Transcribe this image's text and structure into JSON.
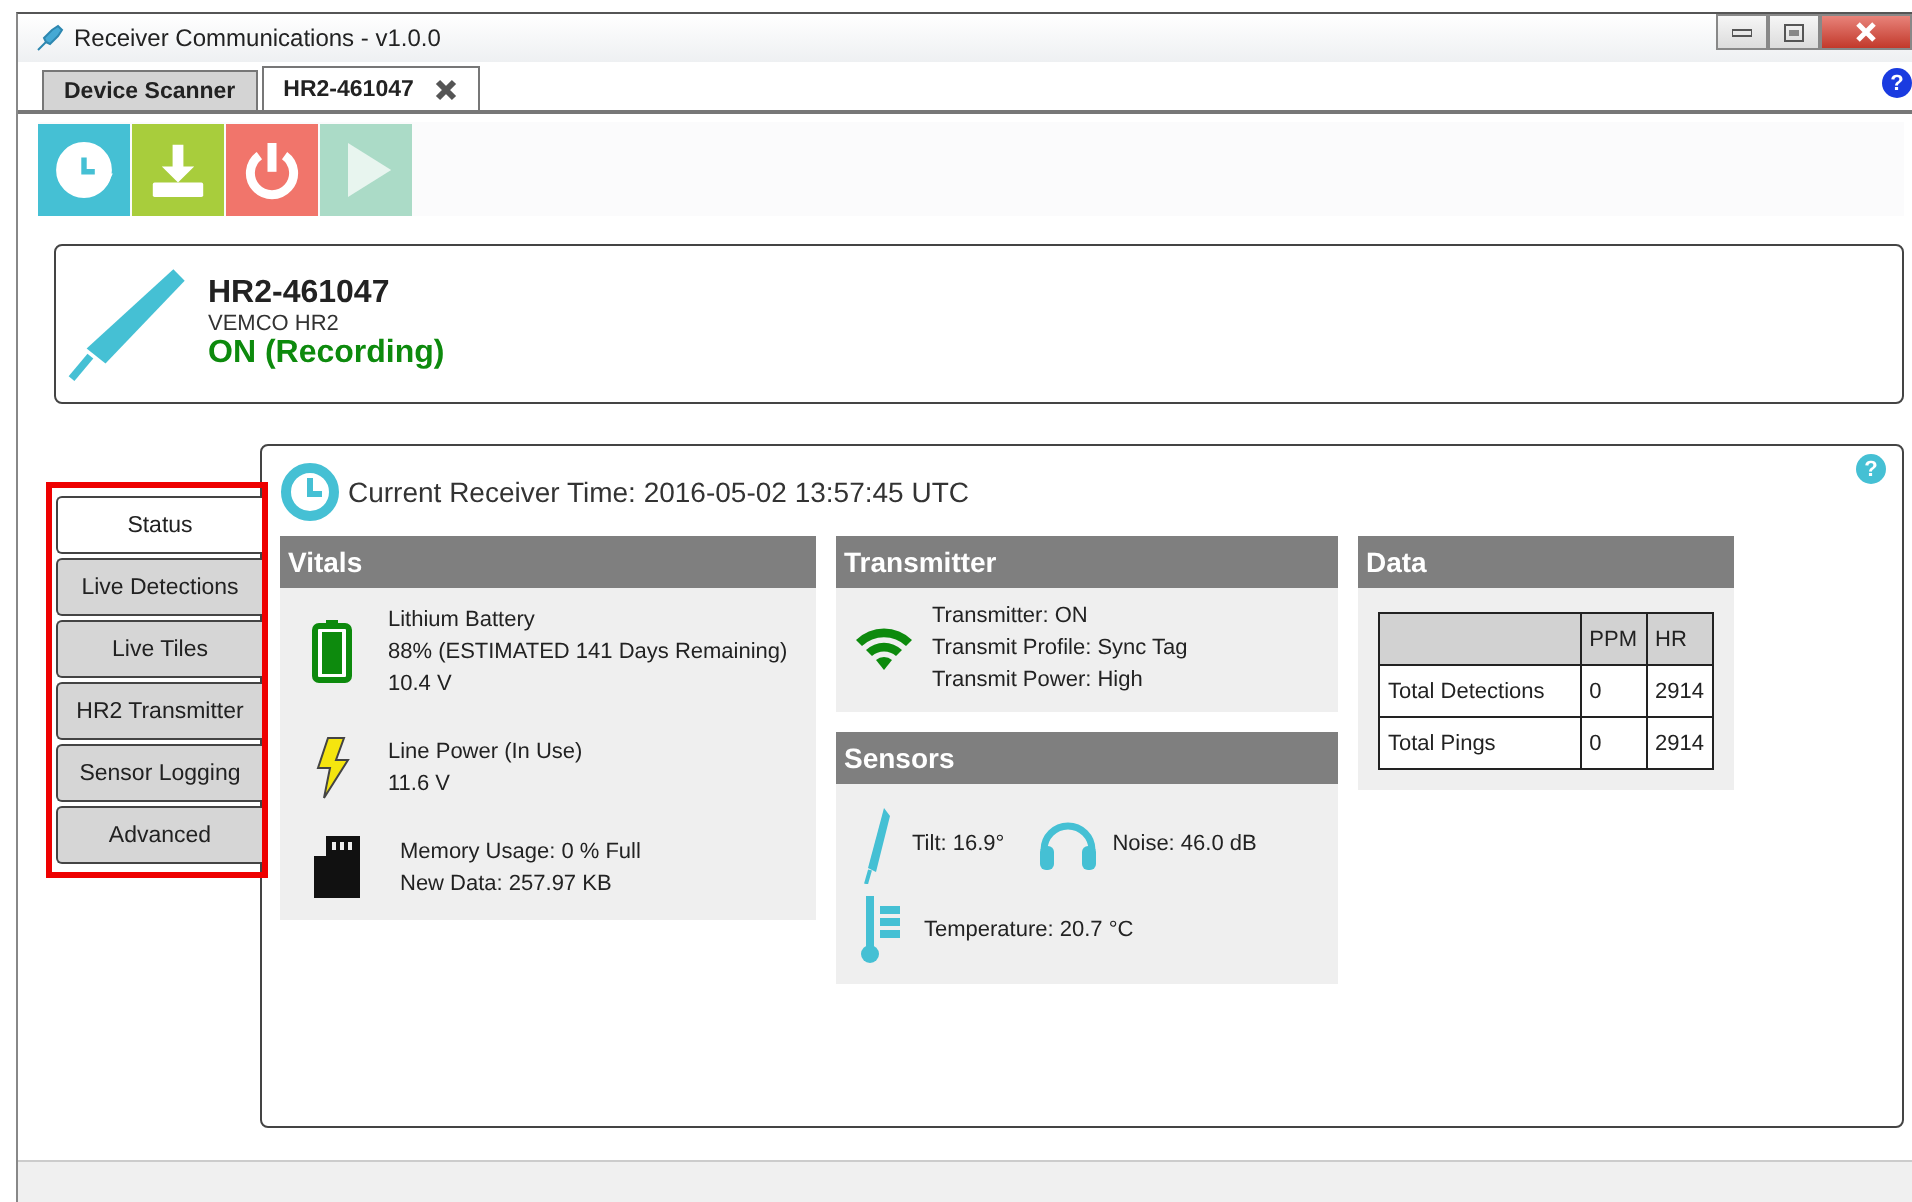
{
  "window": {
    "title": "Receiver Communications - v1.0.0"
  },
  "tabs": [
    {
      "label": "Device Scanner",
      "selected": false,
      "closable": false
    },
    {
      "label": "HR2-461047",
      "selected": true,
      "closable": true
    }
  ],
  "toolbar": [
    {
      "kind": "sync",
      "disabled": false
    },
    {
      "kind": "download",
      "disabled": false
    },
    {
      "kind": "power",
      "disabled": false
    },
    {
      "kind": "play",
      "disabled": true
    }
  ],
  "device": {
    "name": "HR2-461047",
    "model": "VEMCO HR2",
    "status": "ON (Recording)"
  },
  "side_tabs": [
    {
      "label": "Status",
      "selected": true
    },
    {
      "label": "Live Detections",
      "selected": false
    },
    {
      "label": "Live Tiles",
      "selected": false
    },
    {
      "label": "HR2 Transmitter",
      "selected": false
    },
    {
      "label": "Sensor Logging",
      "selected": false
    },
    {
      "label": "Advanced",
      "selected": false
    }
  ],
  "receiver_time": "Current Receiver Time: 2016-05-02 13:57:45 UTC",
  "vitals": {
    "title": "Vitals",
    "items": [
      {
        "kind": "battery",
        "lines": [
          "Lithium Battery",
          "88% (ESTIMATED 141 Days Remaining)",
          "10.4 V"
        ]
      },
      {
        "kind": "power",
        "lines": [
          "Line Power (In Use)",
          "11.6 V"
        ]
      },
      {
        "kind": "memory",
        "lines": [
          "Memory Usage: 0 % Full",
          "New Data: 257.97 KB"
        ]
      }
    ]
  },
  "transmitter": {
    "title": "Transmitter",
    "lines": [
      "Transmitter: ON",
      "Transmit Profile: Sync Tag",
      "Transmit Power: High"
    ]
  },
  "sensors": {
    "title": "Sensors",
    "items": [
      {
        "kind": "tilt",
        "label": "Tilt:  16.9°"
      },
      {
        "kind": "noise",
        "label": "Noise:  46.0 dB"
      },
      {
        "kind": "temperature",
        "label": "Temperature:  20.7 °C"
      }
    ]
  },
  "data": {
    "title": "Data",
    "columns": [
      "PPM",
      "HR"
    ],
    "rows": [
      {
        "label": "Total Detections",
        "values": [
          "0",
          "2914"
        ]
      },
      {
        "label": "Total Pings",
        "values": [
          "0",
          "2914"
        ]
      }
    ]
  },
  "help_icons": [
    "?",
    "?"
  ]
}
